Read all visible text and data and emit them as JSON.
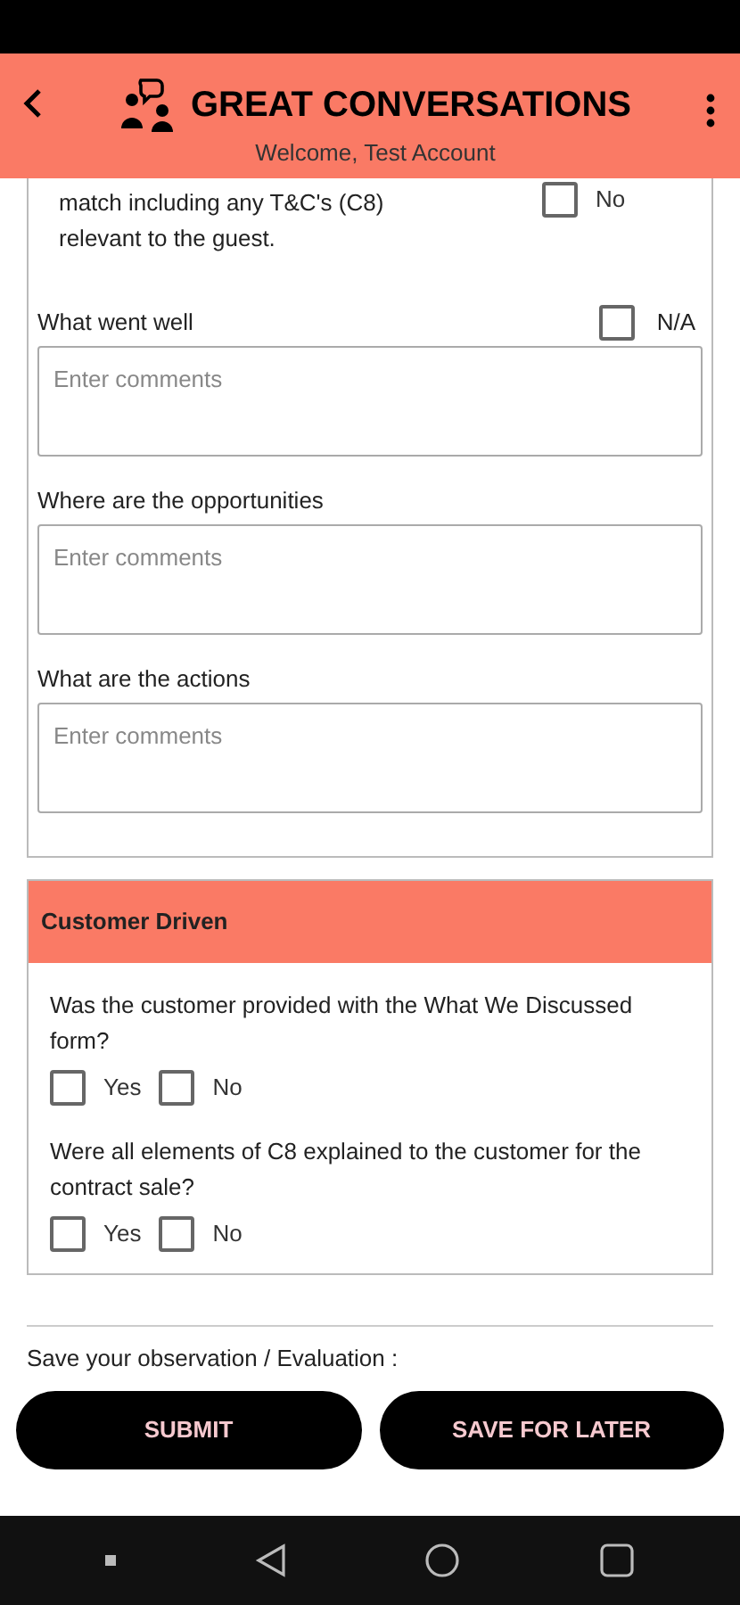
{
  "header": {
    "title": "GREAT CONVERSATIONS",
    "subtitle": "Welcome, Test Account"
  },
  "top_question": {
    "text": "match including any T&C's (C8) relevant to the guest.",
    "options": [
      {
        "label": "No",
        "checked": false
      }
    ]
  },
  "comment_fields": [
    {
      "label": "What went well",
      "placeholder": "Enter comments",
      "na": {
        "label": "N/A",
        "checked": false
      }
    },
    {
      "label": "Where are the opportunities",
      "placeholder": "Enter comments"
    },
    {
      "label": "What are the actions",
      "placeholder": "Enter comments"
    }
  ],
  "section": {
    "title": "Customer Driven",
    "questions": [
      {
        "text": "Was the customer provided with the What We Discussed form?",
        "options": [
          {
            "label": "Yes",
            "checked": false
          },
          {
            "label": "No",
            "checked": false
          }
        ]
      },
      {
        "text": "Were all elements of C8 explained to the customer for the contract sale?",
        "options": [
          {
            "label": "Yes",
            "checked": false
          },
          {
            "label": "No",
            "checked": false
          }
        ]
      }
    ]
  },
  "footer": {
    "label": "Save your observation / Evaluation :",
    "buttons": [
      "SUBMIT",
      "SAVE FOR LATER"
    ]
  }
}
